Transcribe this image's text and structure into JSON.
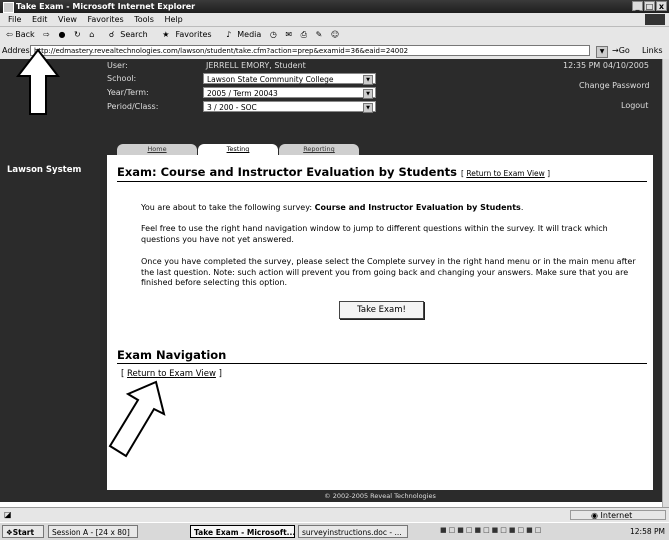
{
  "window": {
    "title": "Take Exam - Microsoft Internet Explorer",
    "controls": [
      "_",
      "□",
      "x"
    ]
  },
  "menu": [
    "File",
    "Edit",
    "View",
    "Favorites",
    "Tools",
    "Help"
  ],
  "toolbar": {
    "back": "⇦ Back",
    "fwd": "⇨",
    "search": "Search",
    "favorites": "Favorites",
    "media": "Media"
  },
  "address": {
    "label": "Address",
    "url": "http://edmastery.revealtechnologies.com/lawson/student/take.cfm?action=prep&examid=36&eaid=24002",
    "go": "Go",
    "links": "Links"
  },
  "header": {
    "user_label": "User:",
    "user_value": "JERRELL EMORY, Student",
    "school_label": "School:",
    "school_value": "Lawson State Community College",
    "term_label": "Year/Term:",
    "term_value": "2005 / Term 20043",
    "period_label": "Period/Class:",
    "period_value": "3 / 200 - SOC",
    "datetime": "12:35 PM 04/10/2005",
    "change_password": "Change Password",
    "logout": "Logout"
  },
  "tabs": [
    "Home",
    "Testing",
    "Reporting"
  ],
  "sidebar": {
    "title": "Lawson System"
  },
  "exam": {
    "title": "Exam: Course and Instructor Evaluation by Students",
    "return_link": "Return to Exam View",
    "para1_prefix": "You are about to take the following survey: ",
    "para1_bold": "Course and Instructor Evaluation by Students",
    "para1_suffix": ".",
    "para2": "Feel free to use the right hand navigation window to jump to different questions within the survey. It will track which questions you have not yet answered.",
    "para3": "Once you have completed the survey, please select the Complete survey in the right hand menu or in the main menu after the last question. Note: such action will prevent you from going back and changing your answers. Make sure that you are finished before selecting this option.",
    "take_button": "Take Exam!"
  },
  "navigation": {
    "title": "Exam Navigation",
    "open_bracket": "[",
    "link": "Return to Exam View",
    "close_bracket": "]"
  },
  "footer": "© 2002-2005 Reveal Technologies",
  "status": {
    "zone": "Internet"
  },
  "taskbar": {
    "start": "Start",
    "items": [
      "Session A - [24 x 80]",
      "Take Exam - Microsoft...",
      "surveyinstructions.doc - ..."
    ],
    "clock": "12:58 PM"
  },
  "colors": {
    "dark_band": "#2b2b2b",
    "tab_bg": "#cfcfcf"
  }
}
